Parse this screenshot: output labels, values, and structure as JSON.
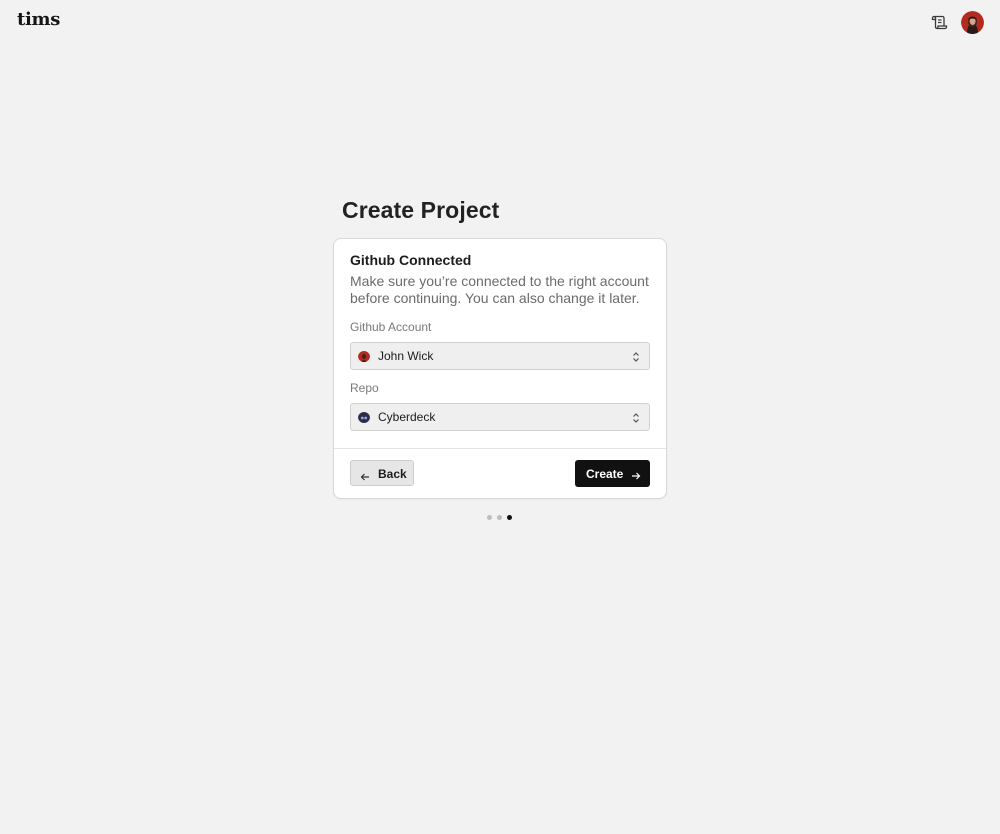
{
  "app": {
    "logo": "tims"
  },
  "header": {
    "docs_icon": "scroll-icon",
    "avatar": "user-avatar"
  },
  "page": {
    "title": "Create Project"
  },
  "card": {
    "heading": "Github Connected",
    "description": "Make sure you’re connected to the right account before continuing. You can also change it later.",
    "account": {
      "label": "Github Account",
      "value": "John Wick",
      "icon": "user-avatar"
    },
    "repo": {
      "label": "Repo",
      "value": "Cyberdeck",
      "icon": "repo-avatar"
    },
    "back_label": "Back",
    "create_label": "Create"
  },
  "stepper": {
    "steps": 3,
    "current": 3
  },
  "colors": {
    "background": "#f2f2f2",
    "primary_button": "#111111",
    "avatar_red": "#b32a1f"
  }
}
